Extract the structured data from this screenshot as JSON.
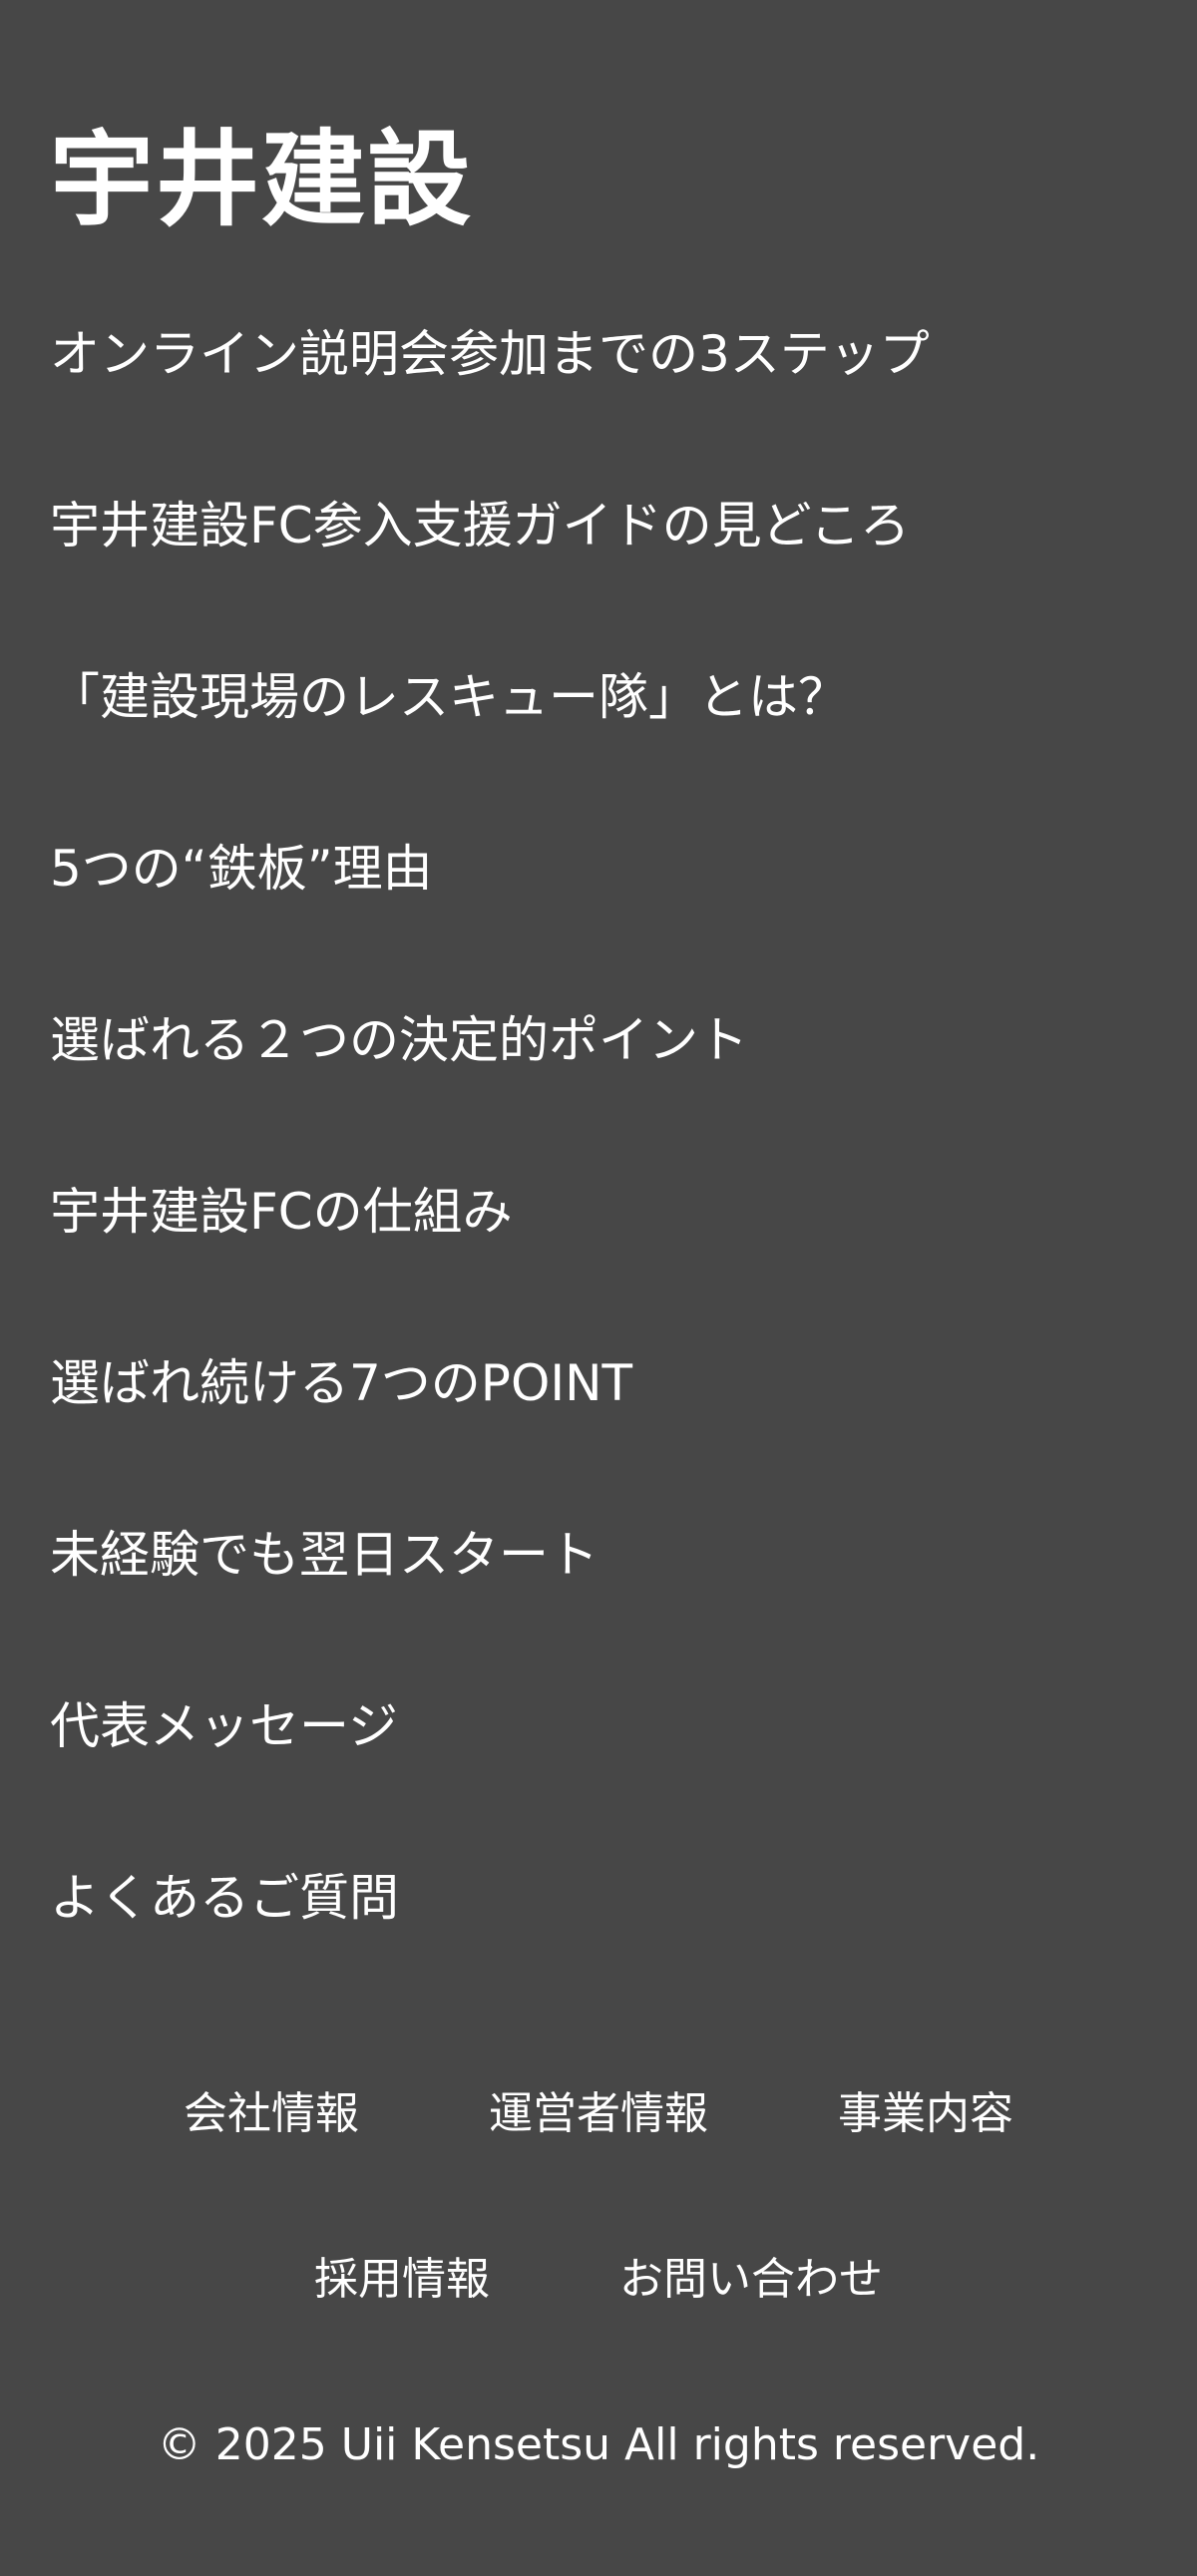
{
  "header": {
    "logo_text": "宇井建設"
  },
  "menu": {
    "items": [
      {
        "label": "オンライン説明会参加までの3ステップ"
      },
      {
        "label": "宇井建設FC参入支援ガイドの見どころ"
      },
      {
        "label": "「建設現場のレスキュー隊」とは？"
      },
      {
        "label": "5つの“鉄板”理由"
      },
      {
        "label": "選ばれる２つの決定的ポイント"
      },
      {
        "label": "宇井建設FCの仕組み"
      },
      {
        "label": "選ばれ続ける7つのPOINT"
      },
      {
        "label": "未経験でも翌日スタート"
      },
      {
        "label": "代表メッセージ"
      },
      {
        "label": "よくあるご質問"
      }
    ]
  },
  "footer": {
    "row1": [
      {
        "label": "会社情報"
      },
      {
        "label": "運営者情報"
      },
      {
        "label": "事業内容"
      }
    ],
    "row2": [
      {
        "label": "採用情報"
      },
      {
        "label": "お問い合わせ"
      }
    ],
    "copyright": "© 2025 Uii Kensetsu All rights reserved."
  },
  "colors": {
    "background": "#474747",
    "text": "#ffffff"
  }
}
